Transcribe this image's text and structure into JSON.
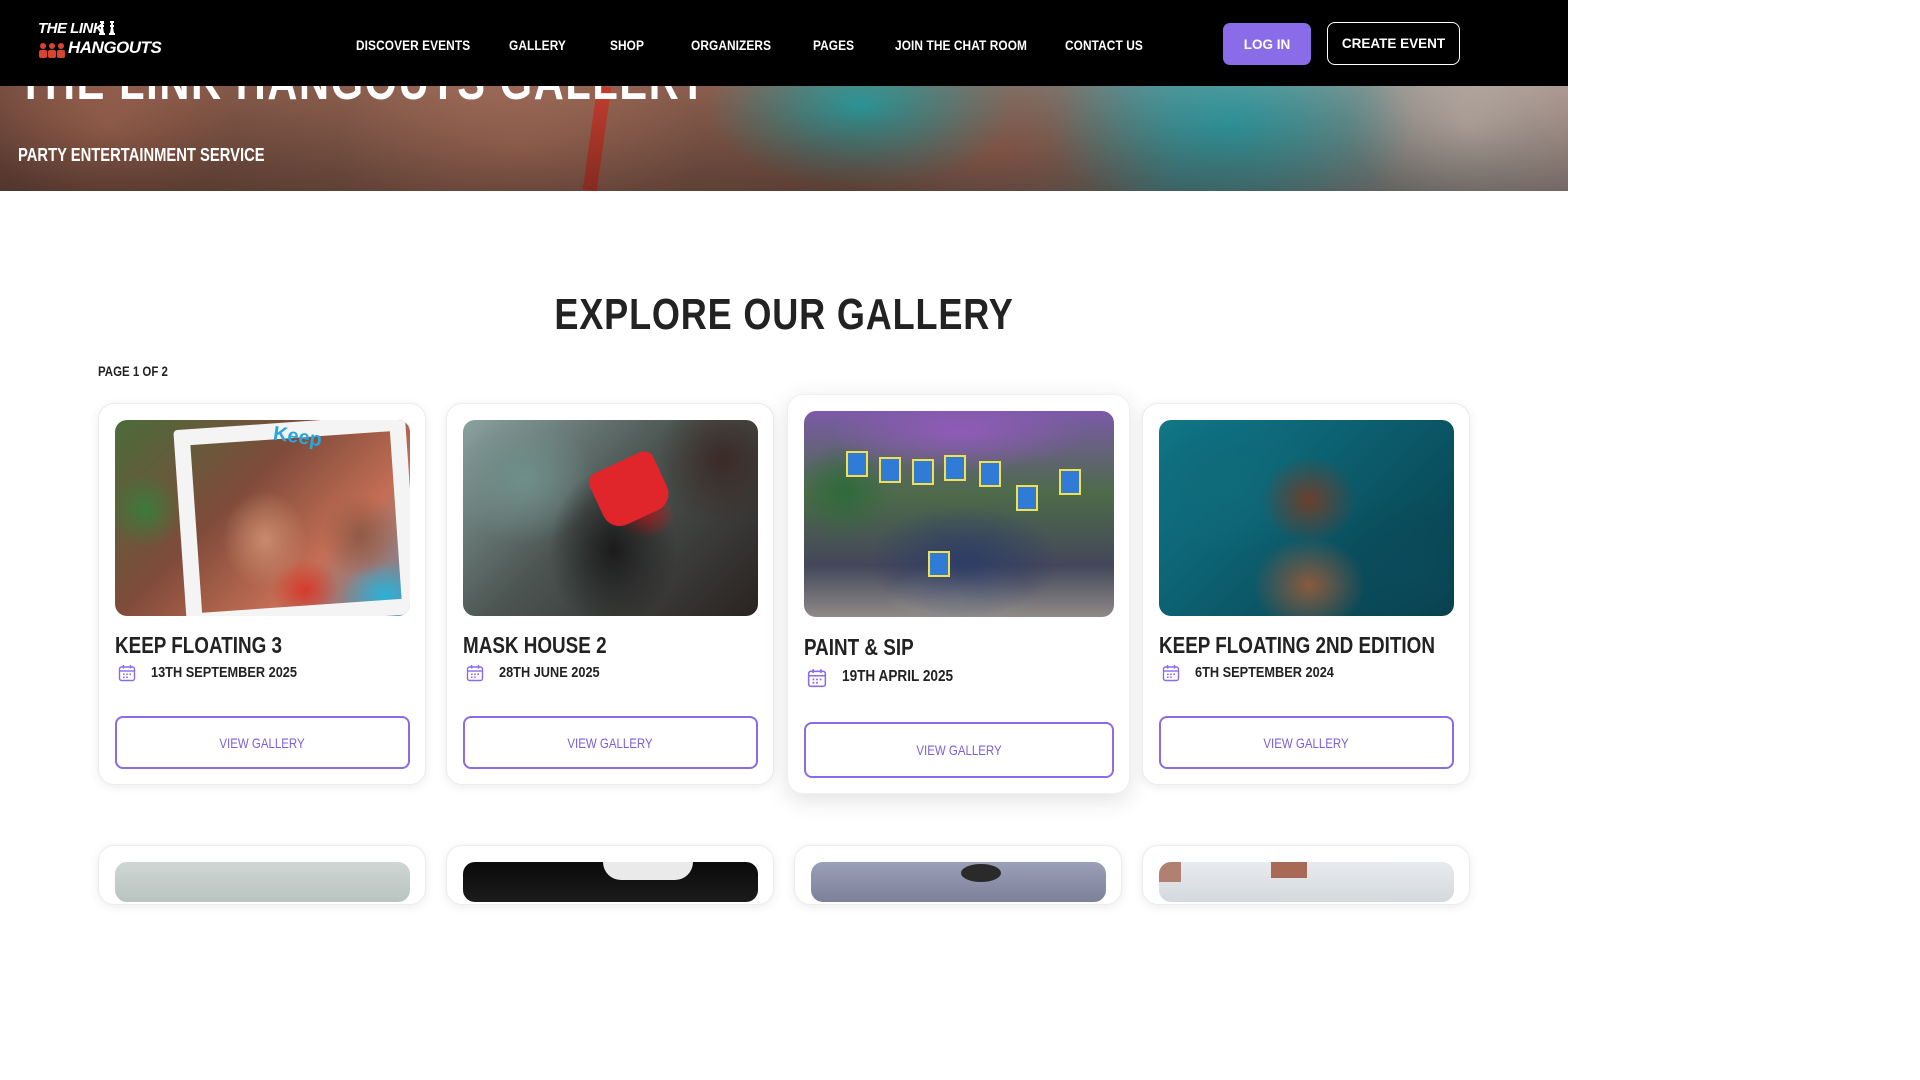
{
  "header": {
    "logo": {
      "line1": "THE LINK",
      "line2": "HANGOUTS"
    },
    "nav": [
      {
        "label": "DISCOVER EVENTS"
      },
      {
        "label": "GALLERY"
      },
      {
        "label": "SHOP"
      },
      {
        "label": "ORGANIZERS"
      },
      {
        "label": "PAGES"
      },
      {
        "label": "JOIN THE CHAT ROOM"
      },
      {
        "label": "CONTACT US"
      }
    ],
    "login_label": "LOG IN",
    "create_event_label": "CREATE EVENT"
  },
  "hero": {
    "title": "THE LINK HANGOUTS GALLERY",
    "subtitle": "PARTY ENTERTAINMENT SERVICE"
  },
  "section": {
    "title": "EXPLORE OUR GALLERY",
    "page_indicator": "PAGE 1 OF 2"
  },
  "cards": [
    {
      "title": "KEEP FLOATING 3",
      "date": "13TH SEPTEMBER 2025",
      "button": "VIEW GALLERY",
      "photo_text": "Keep"
    },
    {
      "title": "MASK HOUSE 2",
      "date": "28TH JUNE 2025",
      "button": "VIEW GALLERY"
    },
    {
      "title": "PAINT & SIP",
      "date": "19TH APRIL 2025",
      "button": "VIEW GALLERY"
    },
    {
      "title": "KEEP FLOATING 2ND EDITION",
      "date": "6TH SEPTEMBER 2024",
      "button": "VIEW GALLERY"
    }
  ],
  "colors": {
    "accent": "#8a6ce8",
    "header_bg": "#000000",
    "text_dark": "#222222"
  },
  "icons": {
    "date": "calendar-icon",
    "logo_mark": "chess-pieces-icon"
  }
}
